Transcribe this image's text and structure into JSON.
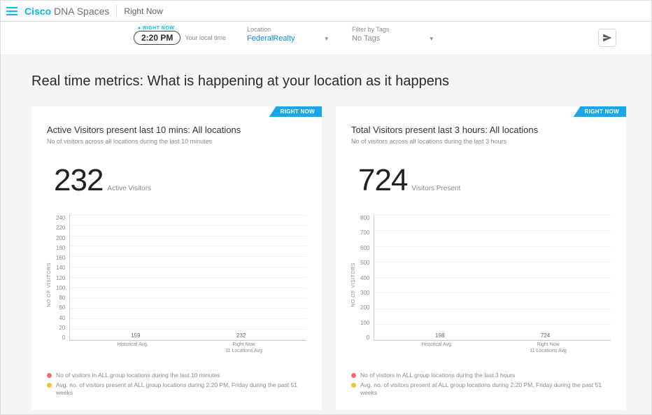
{
  "header": {
    "brand_cisco": "Cisco",
    "brand_rest": " DNA Spaces",
    "crumb": "Right Now"
  },
  "filters": {
    "right_now_tag": "● RIGHT NOW",
    "time": "2:20 PM",
    "local": "Your local time",
    "location_label": "Location",
    "location_value": "FederalRealty",
    "tags_label": "Filter by Tags",
    "tags_value": "No Tags"
  },
  "headline": "Real time metrics: What is happening at your location as it happens",
  "cards": [
    {
      "badge": "RIGHT NOW",
      "title": "Active Visitors present last 10 mins: All locations",
      "sub": "No of visitors across all locations during the last 10 minutes",
      "big_value": "232",
      "big_label": "Active Visitors",
      "legend_red": "No of visitors in ALL group locations during the last 10 minutes",
      "legend_orange": "Avg. no. of visitors present at ALL group locations during 2:20 PM, Friday during the past 51 weeks"
    },
    {
      "badge": "RIGHT NOW",
      "title": "Total Visitors present last 3 hours: All locations",
      "sub": "No of visitors across all locations during the last 3 hours",
      "big_value": "724",
      "big_label": "Visitors Present",
      "legend_red": "No of visitors in ALL group locations during the last 3 hours",
      "legend_orange": "Avg. no. of visitors present at ALL group locations during 2:20 PM, Friday during the past 51 weeks"
    }
  ],
  "chart_data": [
    {
      "type": "bar",
      "title": "Active Visitors present last 10 mins",
      "ylabel": "NO OF VISITORS",
      "ylim": [
        0,
        240
      ],
      "yticks": [
        0,
        20,
        40,
        60,
        80,
        100,
        120,
        140,
        160,
        180,
        200,
        220,
        240
      ],
      "categories": [
        "Historical Avg.",
        "Right Now\n11 Locations Avg"
      ],
      "values": [
        159,
        232
      ],
      "colors": [
        "#f6c23e",
        "#f26c6c"
      ]
    },
    {
      "type": "bar",
      "title": "Total Visitors present last 3 hours",
      "ylabel": "NO OF VISITORS",
      "ylim": [
        0,
        800
      ],
      "yticks": [
        0,
        100,
        200,
        300,
        400,
        500,
        600,
        700,
        800
      ],
      "categories": [
        "Historical Avg.",
        "Right Now\n11 Locations Avg"
      ],
      "values": [
        198,
        724
      ],
      "colors": [
        "#f6c23e",
        "#f26c6c"
      ]
    }
  ]
}
